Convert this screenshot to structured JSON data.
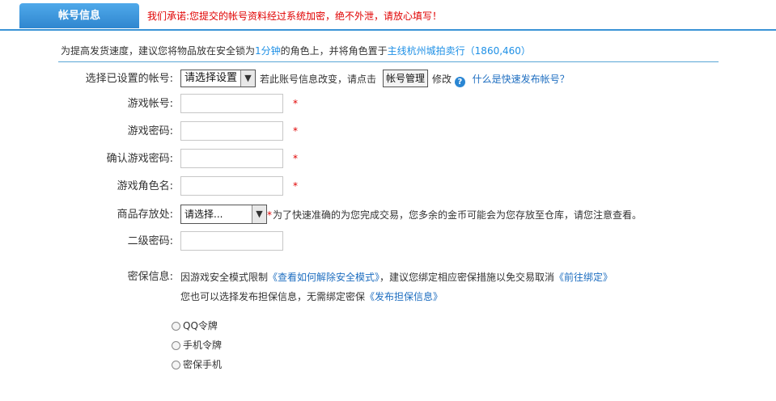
{
  "tabs": {
    "active_label": "帐号信息"
  },
  "promise_text": "我们承诺:您提交的帐号资料经过系统加密，绝不外泄，请放心填写！",
  "tip": {
    "prefix": "为提高发货速度，建议您将物品放在安全锁为",
    "duration": "1分钟",
    "middle": "的角色上，并将角色置于",
    "location": "主线杭州城拍卖行（1860,460）"
  },
  "account_select": {
    "label": "选择已设置的帐号:",
    "selected": "请选择设置",
    "change_text": "若此账号信息改变，请点击",
    "manage_button": "帐号管理",
    "modify_text": "修改",
    "help_icon": "question-icon",
    "help_link": "什么是快速发布帐号？"
  },
  "fields": {
    "account": {
      "label": "游戏帐号:",
      "value": "",
      "required": "*"
    },
    "password": {
      "label": "游戏密码:",
      "value": "",
      "required": "*"
    },
    "confirm_password": {
      "label": "确认游戏密码:",
      "value": "",
      "required": "*"
    },
    "role_name": {
      "label": "游戏角色名:",
      "value": "",
      "required": "*"
    },
    "storage": {
      "label": "商品存放处:",
      "selected": "请选择...",
      "required": "*",
      "note": "为了快速准确的为您完成交易，您多余的金币可能会为您存放至仓库，请您注意查看。"
    },
    "secondary_password": {
      "label": "二级密码:",
      "value": ""
    }
  },
  "security": {
    "label": "密保信息:",
    "line1_prefix": "因游戏安全模式限制",
    "line1_link1": "《查看如何解除安全模式》",
    "line1_middle": "，建议您绑定相应密保措施以免交易取消",
    "line1_link2": "《前往绑定》",
    "line2_prefix": "您也可以选择发布担保信息，无需绑定密保",
    "line2_link": "《发布担保信息》",
    "options": [
      "QQ令牌",
      "手机令牌",
      "密保手机"
    ]
  },
  "colors": {
    "accent": "#3a93d6",
    "warning": "#e00000",
    "link": "#1e6ec0"
  }
}
